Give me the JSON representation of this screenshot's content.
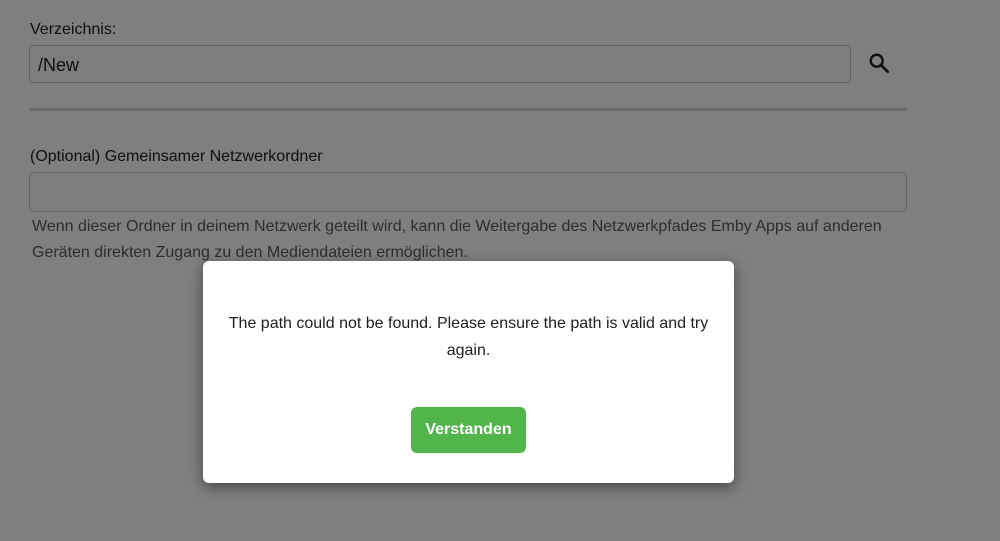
{
  "form": {
    "directory_label": "Verzeichnis:",
    "directory_value": "/New",
    "search_icon": "search-icon",
    "network_share_label": "(Optional) Gemeinsamer Netzwerkordner",
    "network_share_value": "",
    "network_share_help": "Wenn dieser Ordner in deinem Netzwerk geteilt wird, kann die Weitergabe des Netzwerkpfades Emby Apps auf anderen Geräten direkten Zugang zu den Mediendateien ermöglichen."
  },
  "dialog": {
    "message": "The path could not be found. Please ensure the path is valid and try again.",
    "button_label": "Verstanden",
    "button_color": "#52b54b"
  }
}
